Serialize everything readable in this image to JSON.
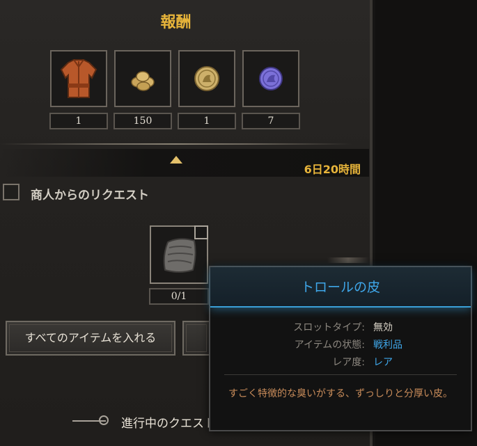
{
  "rewards": {
    "title": "報酬",
    "items": [
      {
        "icon": "tunic-icon",
        "qty": "1"
      },
      {
        "icon": "gold-coins-icon",
        "qty": "150"
      },
      {
        "icon": "gold-medallion-icon",
        "qty": "1"
      },
      {
        "icon": "purple-coin-icon",
        "qty": "7"
      }
    ]
  },
  "timer": "6日20時間",
  "request": {
    "label": "商人からのリクエスト",
    "item_qty": "0/1"
  },
  "buttons": {
    "insert_all": "すべてのアイテムを入れる"
  },
  "quest": {
    "label": "進行中のクエスト"
  },
  "tooltip": {
    "title": "トロールの皮",
    "rows": [
      {
        "key": "スロットタイプ:",
        "value": "無効",
        "color": "#d8d2c6"
      },
      {
        "key": "アイテムの状態:",
        "value": "戦利品",
        "color": "#3fa7ea"
      },
      {
        "key": "レア度:",
        "value": "レア",
        "color": "#3fa7ea"
      }
    ],
    "description": "すごく特徴的な臭いがする、ずっしりと分厚い皮。"
  },
  "colors": {
    "gold": "#e7b43a",
    "rare_blue": "#3fa7ea",
    "desc": "#c98c5a"
  }
}
